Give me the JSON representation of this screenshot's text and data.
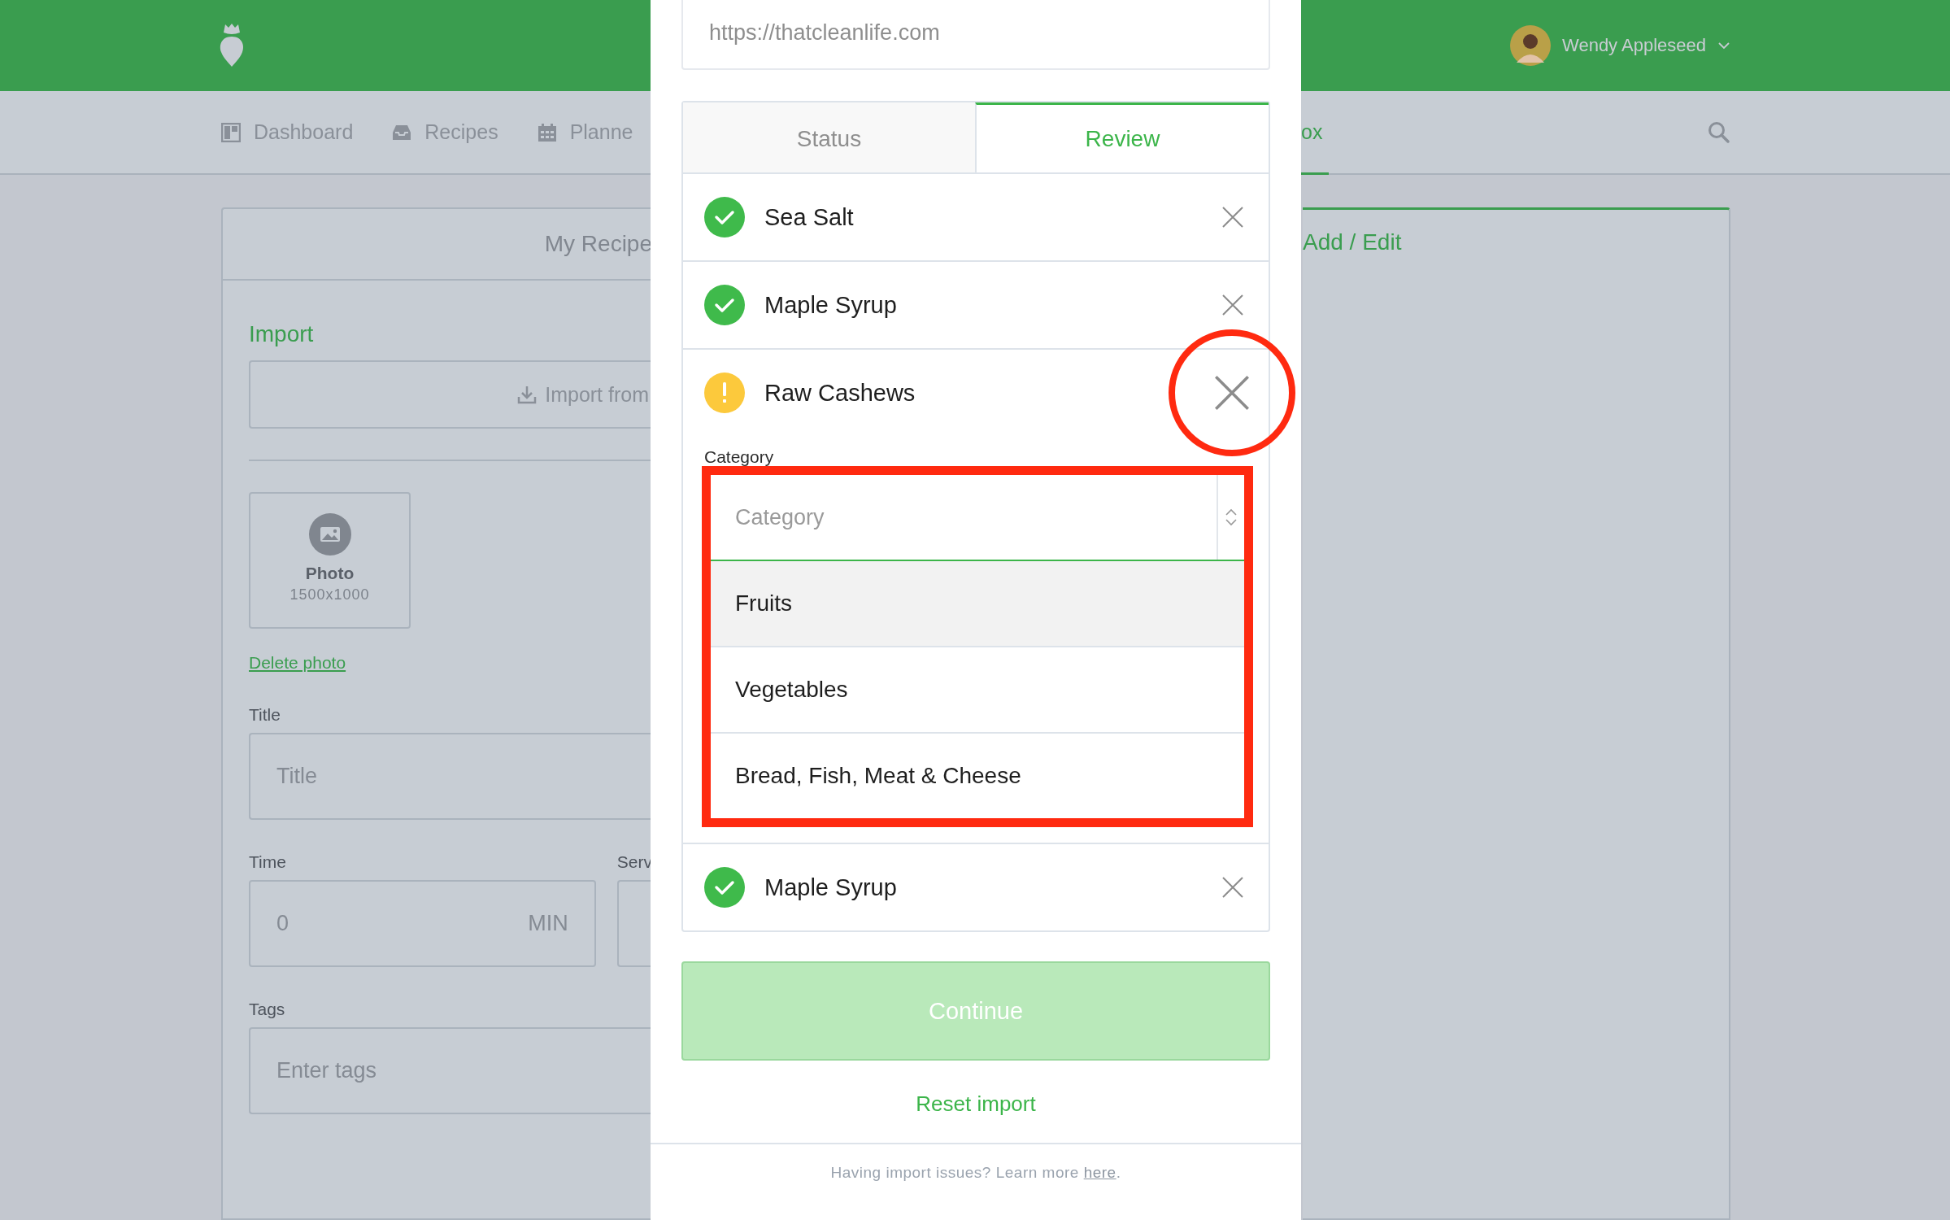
{
  "header": {
    "user_name": "Wendy Appleseed"
  },
  "nav": {
    "left_items": [
      {
        "label": "Dashboard",
        "selected": false
      },
      {
        "label": "Recipes",
        "selected": false
      },
      {
        "label": "Planne",
        "selected": false
      }
    ],
    "right_items": [
      {
        "label": "ox",
        "selected": true
      }
    ]
  },
  "recipe_card": {
    "title": "My Recipe",
    "import_heading": "Import",
    "import_button": "Import from",
    "photo": {
      "label": "Photo",
      "size": "1500x1000"
    },
    "delete_link": "Delete photo",
    "title_field": {
      "label": "Title",
      "placeholder": "Title"
    },
    "time_field": {
      "label": "Time",
      "value": "0",
      "unit": "MIN"
    },
    "servings_field": {
      "label": "Serv"
    },
    "tags_field": {
      "label": "Tags",
      "placeholder": "Enter tags"
    }
  },
  "side_card": {
    "title": "Add / Edit"
  },
  "modal": {
    "url_field": {
      "value": "https://thatcleanlife.com"
    },
    "tabs": [
      {
        "label": "Status",
        "selected": false
      },
      {
        "label": "Review",
        "selected": true
      }
    ],
    "ingredients": [
      {
        "name": "Sea Salt",
        "kind": "ok",
        "remove_highlighted": false
      },
      {
        "name": "Maple Syrup",
        "kind": "ok",
        "remove_highlighted": false
      },
      {
        "name": "Raw Cashews",
        "kind": "warning",
        "remove_highlighted": true,
        "category": {
          "label": "Category",
          "placeholder": "Category",
          "open": true,
          "highlighted": true,
          "options": [
            {
              "label": "Fruits",
              "hovered": true
            },
            {
              "label": "Vegetables",
              "hovered": false
            },
            {
              "label": "Bread, Fish, Meat & Cheese",
              "hovered": false
            }
          ]
        }
      },
      {
        "name": "Maple Syrup",
        "kind": "ok",
        "remove_highlighted": false
      }
    ],
    "continue_button": {
      "label": "Continue",
      "disabled": true
    },
    "reset_link": "Reset import",
    "footer": {
      "text": "Having import issues? Learn more ",
      "link": "here",
      "after": "."
    }
  }
}
